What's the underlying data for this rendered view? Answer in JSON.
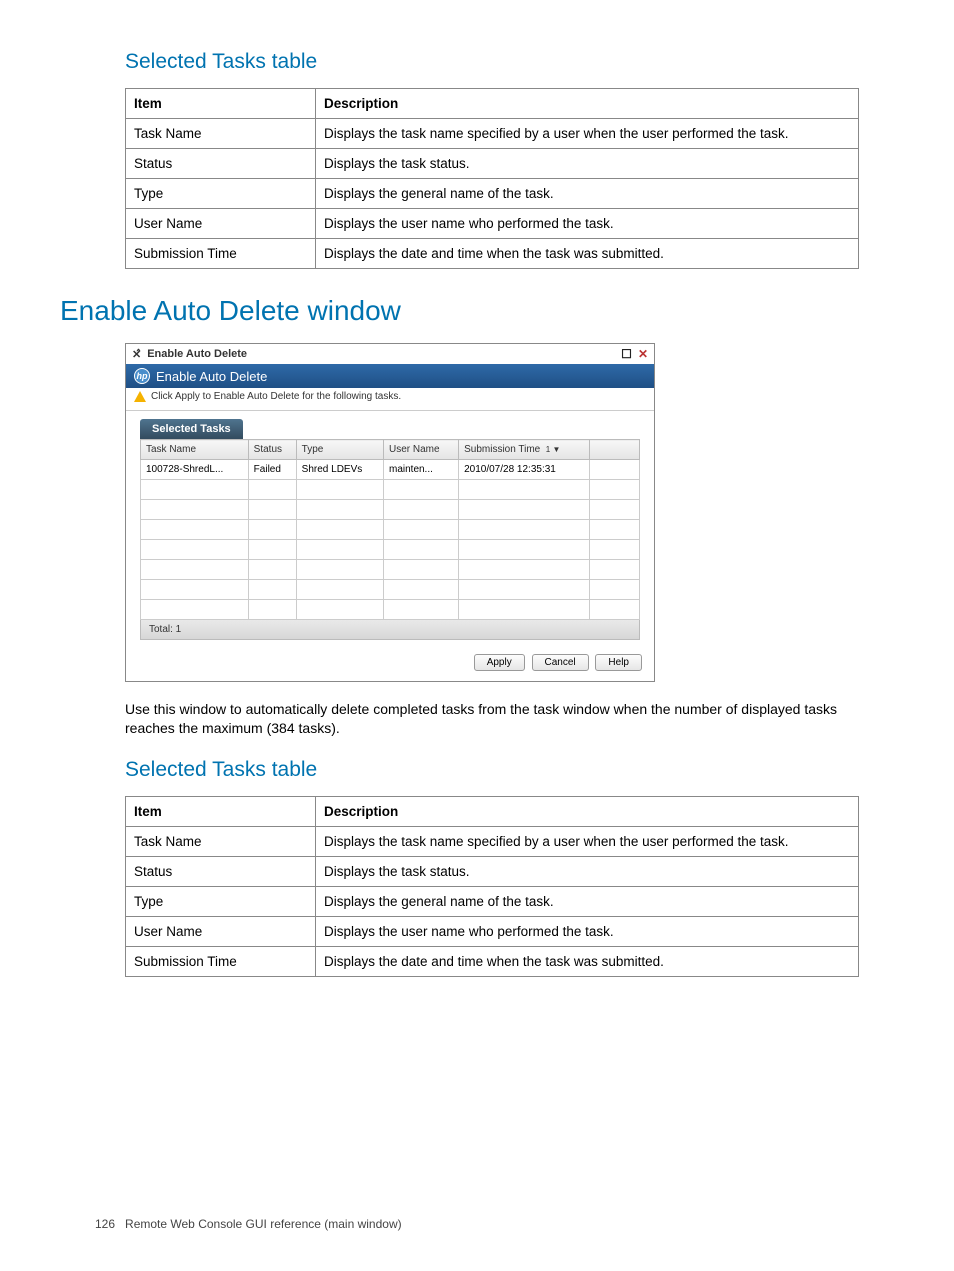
{
  "sections": {
    "selectedTasksTitle": "Selected Tasks table",
    "enableAutoDeleteTitle": "Enable Auto Delete window",
    "useWindowText": "Use this window to automatically delete completed tasks from the task window when the number of displayed tasks reaches the maximum (384 tasks).",
    "selectedTasksTitle2": "Selected Tasks table"
  },
  "descTable": {
    "headers": {
      "item": "Item",
      "description": "Description"
    },
    "rows": [
      {
        "item": "Task Name",
        "desc": "Displays the task name specified by a user when the user performed the task."
      },
      {
        "item": "Status",
        "desc": "Displays the task status."
      },
      {
        "item": "Type",
        "desc": "Displays the general name of the task."
      },
      {
        "item": "User Name",
        "desc": "Displays the user name who performed the task."
      },
      {
        "item": "Submission Time",
        "desc": "Displays the date and time when the task was submitted."
      }
    ]
  },
  "dialog": {
    "outerTitle": "Enable Auto Delete",
    "innerTitle": "Enable Auto Delete",
    "message": "Click Apply to Enable Auto Delete for the following tasks.",
    "tabLabel": "Selected Tasks",
    "columns": {
      "taskName": "Task Name",
      "status": "Status",
      "type": "Type",
      "userName": "User Name",
      "submissionTime": "Submission Time",
      "sortIndicator": "1 ▼"
    },
    "rows": [
      {
        "taskName": "100728-ShredL...",
        "status": "Failed",
        "type": "Shred LDEVs",
        "userName": "mainten...",
        "submissionTime": "2010/07/28 12:35:31"
      }
    ],
    "footerTotal": "Total: 1",
    "buttons": {
      "apply": "Apply",
      "cancel": "Cancel",
      "help": "Help"
    }
  },
  "footer": {
    "pageNum": "126",
    "footerText": "Remote Web Console GUI reference (main window)"
  }
}
